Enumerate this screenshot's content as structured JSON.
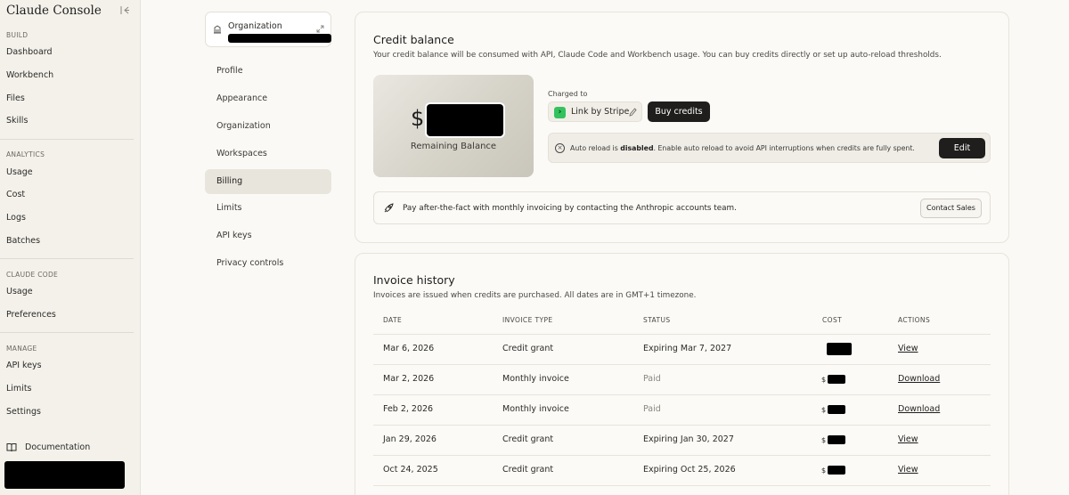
{
  "sidebar": {
    "brand": "Claude Console",
    "sections": [
      {
        "title": "BUILD",
        "items": [
          "Dashboard",
          "Workbench",
          "Files",
          "Skills"
        ]
      },
      {
        "title": "ANALYTICS",
        "items": [
          "Usage",
          "Cost",
          "Logs",
          "Batches"
        ]
      },
      {
        "title": "CLAUDE CODE",
        "items": [
          "Usage",
          "Preferences"
        ]
      },
      {
        "title": "MANAGE",
        "items": [
          "API keys",
          "Limits",
          "Settings"
        ]
      }
    ],
    "documentation": "Documentation"
  },
  "org": {
    "label": "Organization"
  },
  "settings_nav": [
    "Profile",
    "Appearance",
    "Organization",
    "Workspaces",
    "Billing",
    "Limits",
    "API keys",
    "Privacy controls"
  ],
  "settings_active": "Billing",
  "credit": {
    "title": "Credit balance",
    "description": "Your credit balance will be consumed with API, Claude Code and Workbench usage. You can buy credits directly or set up auto-reload thresholds.",
    "currency": "$",
    "remaining_label": "Remaining Balance",
    "charged_to": "Charged to",
    "payment_method": "Link by Stripe",
    "buy_label": "Buy credits",
    "auto_reload_prefix": "Auto reload is ",
    "auto_reload_state": "disabled",
    "auto_reload_suffix": ". Enable auto reload to avoid API interruptions when credits are fully spent.",
    "edit_label": "Edit",
    "sales_text": "Pay after-the-fact with monthly invoicing by contacting the Anthropic accounts team.",
    "contact_label": "Contact Sales"
  },
  "invoices": {
    "title": "Invoice history",
    "description": "Invoices are issued when credits are purchased. All dates are in GMT+1 timezone.",
    "columns": [
      "DATE",
      "INVOICE TYPE",
      "STATUS",
      "COST",
      "ACTIONS"
    ],
    "rows": [
      {
        "date": "Mar 6, 2026",
        "type": "Credit grant",
        "status": "Expiring Mar 7, 2027",
        "muted": false,
        "currency": "",
        "action": "View"
      },
      {
        "date": "Mar 2, 2026",
        "type": "Monthly invoice",
        "status": "Paid",
        "muted": true,
        "currency": "$",
        "action": "Download"
      },
      {
        "date": "Feb 2, 2026",
        "type": "Monthly invoice",
        "status": "Paid",
        "muted": true,
        "currency": "$",
        "action": "Download"
      },
      {
        "date": "Jan 29, 2026",
        "type": "Credit grant",
        "status": "Expiring Jan 30, 2027",
        "muted": false,
        "currency": "$",
        "action": "View"
      },
      {
        "date": "Oct 24, 2025",
        "type": "Credit grant",
        "status": "Expiring Oct 25, 2026",
        "muted": false,
        "currency": "$",
        "action": "View"
      }
    ]
  }
}
